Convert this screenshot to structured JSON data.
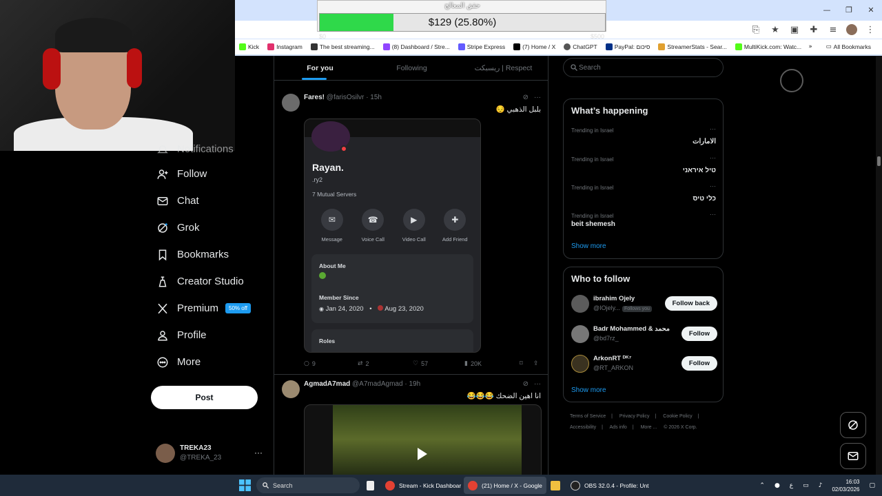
{
  "browser": {
    "window_title": "حقق المعالج",
    "bookmarks": [
      {
        "label": "Kick",
        "color": "#53fc18"
      },
      {
        "label": "Instagram",
        "color": "#e1306c"
      },
      {
        "label": "The best streaming...",
        "color": "#333333"
      },
      {
        "label": "(8) Dashboard / Stre...",
        "color": "#9146ff"
      },
      {
        "label": "Stripe Express",
        "color": "#635bff"
      },
      {
        "label": "(7) Home / X",
        "color": "#000000"
      },
      {
        "label": "ChatGPT",
        "color": "#555555"
      },
      {
        "label": "PayPal: סיכום",
        "color": "#003087"
      },
      {
        "label": "StreamerStats - Sear...",
        "color": "#e0a030"
      },
      {
        "label": "MultiKick.com: Watc...",
        "color": "#53fc18"
      }
    ],
    "all_bookmarks": "All Bookmarks"
  },
  "donation_goal": {
    "title": "حقق المعالج",
    "amount_text": "$129 (25.80%)",
    "fill_fraction": 0.258,
    "min_label": "$0",
    "max_label": "$500"
  },
  "nav": {
    "items": [
      {
        "label": "Notifications",
        "icon": "bell-icon"
      },
      {
        "label": "Follow",
        "icon": "follow-icon"
      },
      {
        "label": "Chat",
        "icon": "chat-icon"
      },
      {
        "label": "Grok",
        "icon": "grok-icon"
      },
      {
        "label": "Bookmarks",
        "icon": "bookmark-icon"
      },
      {
        "label": "Creator Studio",
        "icon": "creator-studio-icon"
      },
      {
        "label": "Premium",
        "icon": "x-logo-icon",
        "badge": "50% off"
      },
      {
        "label": "Profile",
        "icon": "profile-icon"
      },
      {
        "label": "More",
        "icon": "more-icon"
      }
    ],
    "post_label": "Post",
    "account": {
      "name": "TREKA23",
      "handle": "@TREKA_23"
    }
  },
  "feed": {
    "tabs": [
      "For you",
      "Following",
      "ريسبكت | Respect"
    ],
    "tweets": [
      {
        "name": "Fares!",
        "handle": "@farisOsilvr",
        "time": "15h",
        "text": "بلبل الذهبي 😔",
        "metrics": {
          "replies": "9",
          "reposts": "2",
          "likes": "57",
          "views": "20K"
        }
      },
      {
        "name": "AgmadA7mad",
        "handle": "@A7madAgmad",
        "time": "19h",
        "text": "انا اهين الضحك 😂😂😂"
      }
    ],
    "discord_card": {
      "display_name": "Rayan.",
      "username": ".ry2",
      "mutual": "7 Mutual Servers",
      "actions": [
        "Message",
        "Voice Call",
        "Video Call",
        "Add Friend"
      ],
      "about_me_label": "About Me",
      "member_since_label": "Member Since",
      "discord_date": "Jan 24, 2020",
      "server_date": "Aug 23, 2020",
      "roles_label": "Roles"
    }
  },
  "sidebar": {
    "search_placeholder": "Search",
    "whats_happening": "What’s happening",
    "trends": [
      {
        "category": "Trending in Israel",
        "title": "الامارات",
        "rtl": true
      },
      {
        "category": "Trending in Israel",
        "title": "טיל איראני",
        "rtl": true
      },
      {
        "category": "Trending in Israel",
        "title": "כלי טיס",
        "rtl": true
      },
      {
        "category": "Trending in Israel",
        "title": "beit shemesh",
        "rtl": false
      }
    ],
    "show_more": "Show more",
    "who_to_follow": "Who to follow",
    "suggestions": [
      {
        "name": "ibrahim Ojely",
        "handle": "@IOjely...",
        "follows_you": "Follows you",
        "button": "Follow back"
      },
      {
        "name": "Badr Mohammed & محمد",
        "handle": "@bd7rz_",
        "button": "Follow"
      },
      {
        "name": "ArkonRT ᴰᴷ⁷",
        "handle": "@RT_ARKON",
        "button": "Follow"
      }
    ],
    "show_more_2": "Show more",
    "footer": [
      "Terms of Service",
      "Privacy Policy",
      "Cookie Policy",
      "Accessibility",
      "Ads info",
      "More ...",
      "© 2026 X Corp."
    ]
  },
  "taskbar": {
    "search": "Search",
    "apps": [
      {
        "label": "Stream - Kick Dashboar",
        "color": "#e34133"
      },
      {
        "label": "(21) Home / X - Google",
        "color": "#e34133"
      },
      {
        "label": "OBS 32.0.4 - Profile: Unt",
        "color": "#222222"
      }
    ],
    "lang": "ع",
    "time": "16:03",
    "date": "02/03/2026"
  }
}
